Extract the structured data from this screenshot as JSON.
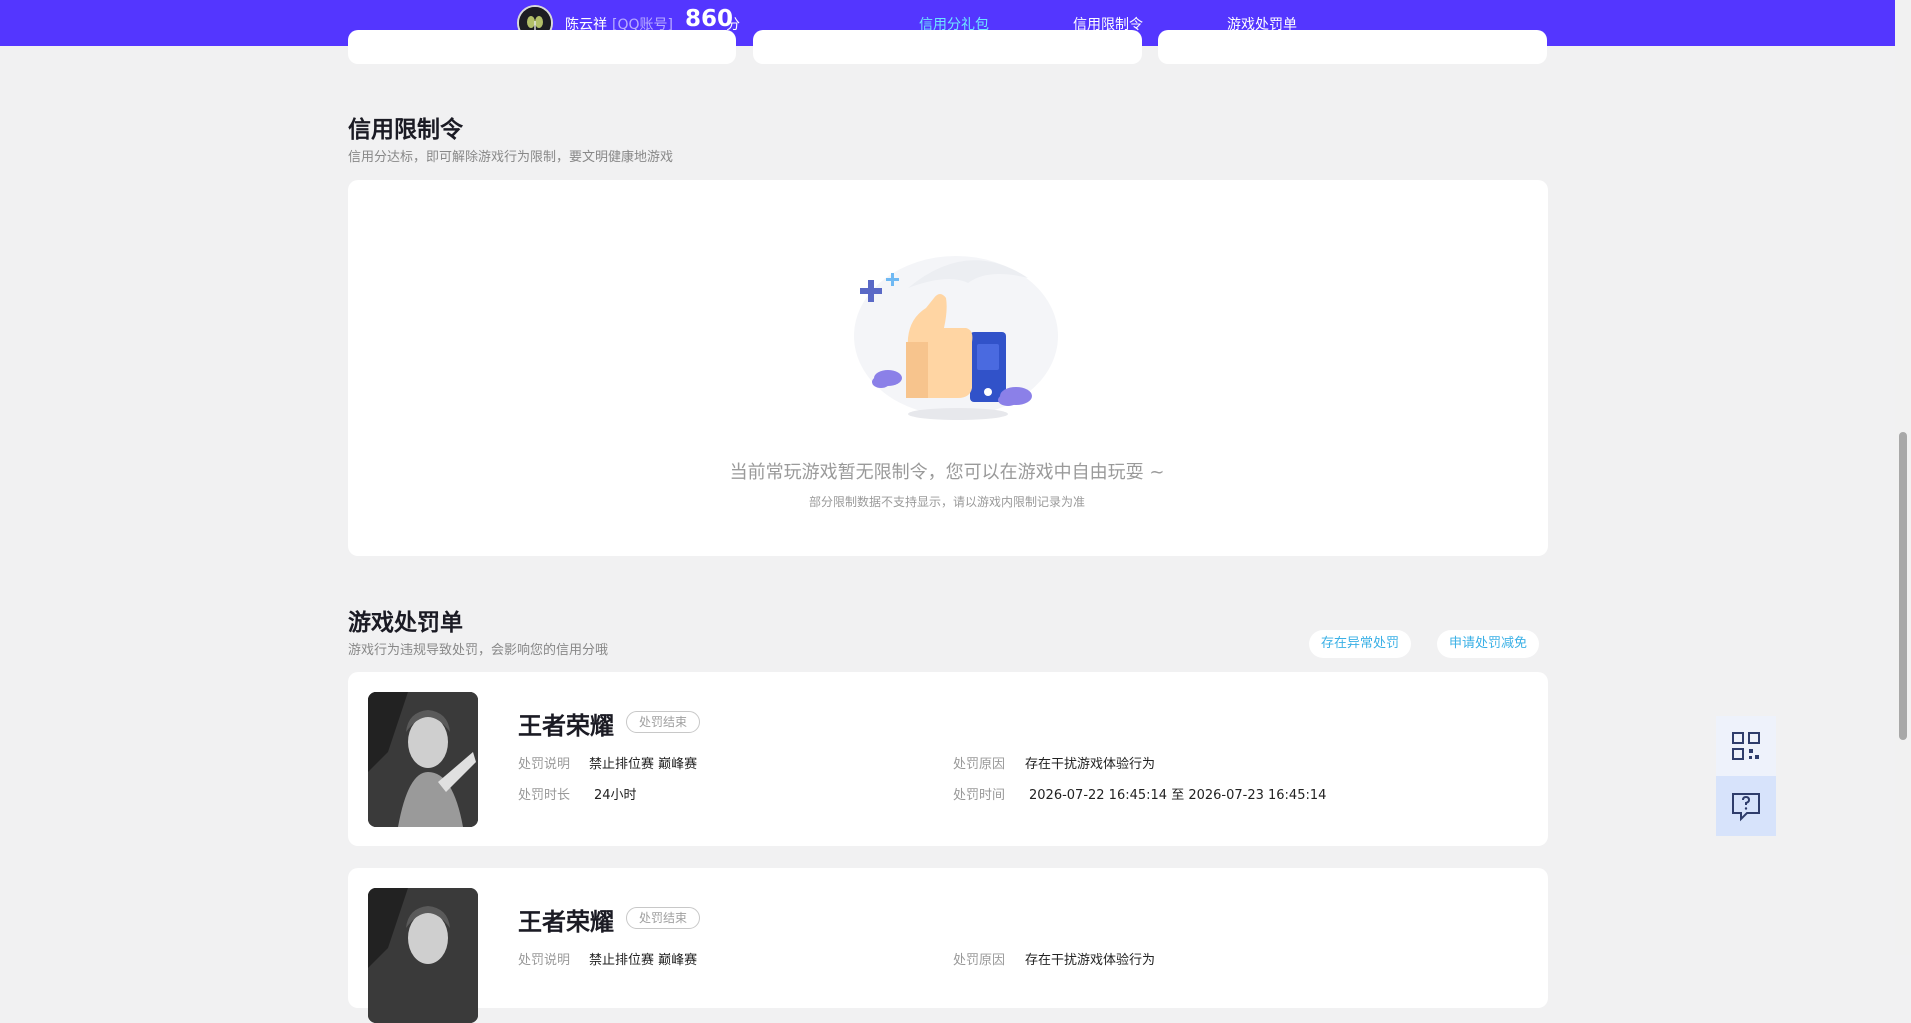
{
  "header": {
    "user_name": "陈云祥",
    "account_type": "[QQ账号]",
    "score": "860",
    "score_unit": "分",
    "nav": [
      {
        "label": "信用分礼包",
        "active": true
      },
      {
        "label": "信用限制令",
        "active": false
      },
      {
        "label": "游戏处罚单",
        "active": false
      }
    ],
    "colors": {
      "bar": "#5436ff",
      "active": "#6ee6ff"
    }
  },
  "restriction_section": {
    "title": "信用限制令",
    "subtitle": "信用分达标，即可解除游戏行为限制，要文明健康地游戏",
    "empty_title": "当前常玩游戏暂无限制令，您可以在游戏中自由玩耍 ~",
    "empty_sub": "部分限制数据不支持显示，请以游戏内限制记录为准",
    "illustration_icon": "thumbs-up-illustration"
  },
  "penalty_section": {
    "title": "游戏处罚单",
    "subtitle": "游戏行为违规导致处罚，会影响您的信用分哦",
    "actions": [
      "存在异常处罚",
      "申请处罚减免"
    ],
    "records": [
      {
        "game": "王者荣耀",
        "status": "处罚结束",
        "desc_label": "处罚说明",
        "desc_value": "禁止排位赛 巅峰赛",
        "duration_label": "处罚时长",
        "duration_value": "24小时",
        "reason_label": "处罚原因",
        "reason_value": "存在干扰游戏体验行为",
        "time_label": "处罚时间",
        "time_value": "2026-07-22 16:45:14 至 2026-07-23 16:45:14"
      },
      {
        "game": "王者荣耀",
        "status": "处罚结束",
        "desc_label": "处罚说明",
        "desc_value": "禁止排位赛 巅峰赛",
        "reason_label": "处罚原因",
        "reason_value": "存在干扰游戏体验行为"
      }
    ]
  },
  "float_panel": {
    "icons": [
      "qr-code-icon",
      "feedback-icon"
    ]
  }
}
